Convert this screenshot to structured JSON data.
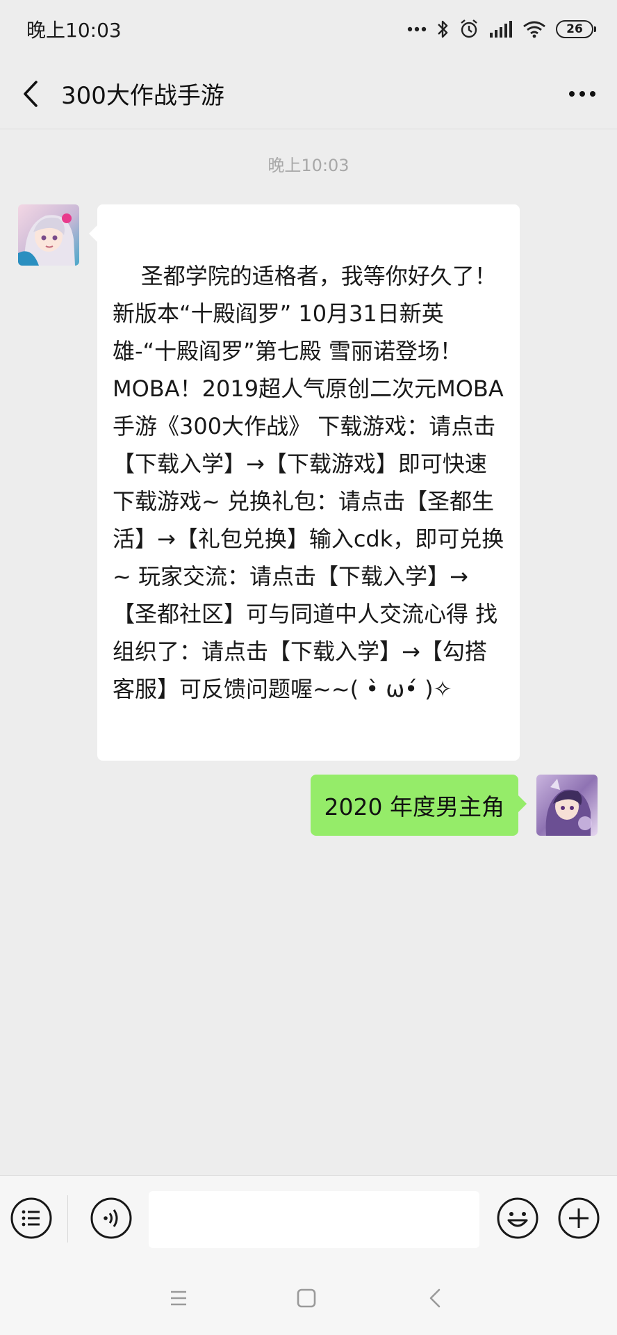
{
  "status_bar": {
    "time": "晚上10:03",
    "battery": "26",
    "icons": [
      "dots-icon",
      "bluetooth-icon",
      "alarm-icon",
      "signal-icon",
      "wifi-icon",
      "battery-icon"
    ]
  },
  "header": {
    "title": "300大作战手游",
    "back_icon": "chevron-left-icon",
    "more_icon": "more-dots-icon"
  },
  "chat": {
    "timestamp": "晚上10:03",
    "messages": [
      {
        "direction": "incoming",
        "avatar": "game-official-avatar",
        "text": "圣都学院的适格者，我等你好久了！新版本“十殿阎罗” 10月31日新英雄-“十殿阎罗”第七殿 雪丽诺登场！MOBA！2019超人气原创二次元MOBA手游《300大作战》 下载游戏：请点击【下载入学】→【下载游戏】即可快速下载游戏~ 兑换礼包：请点击【圣都生活】→【礼包兑换】输入cdk，即可兑换~ 玩家交流：请点击【下载入学】→【圣都社区】可与同道中人交流心得 找组织了：请点击【下载入学】→【勾搭客服】可反馈问题喔~~( •̀ ω•́ )✧"
      },
      {
        "direction": "outgoing",
        "avatar": "user-avatar",
        "text": "2020 年度男主角"
      }
    ]
  },
  "input_bar": {
    "menu_icon": "list-menu-icon",
    "voice_icon": "voice-icon",
    "input_value": "",
    "emoji_icon": "emoji-icon",
    "add_icon": "plus-icon"
  },
  "system_nav": {
    "icons": [
      "menu-lines-icon",
      "home-square-icon",
      "back-triangle-icon"
    ]
  },
  "colors": {
    "background": "#ededed",
    "incoming_bubble": "#ffffff",
    "outgoing_bubble": "#95ec69",
    "timestamp": "#a8a8a8"
  }
}
